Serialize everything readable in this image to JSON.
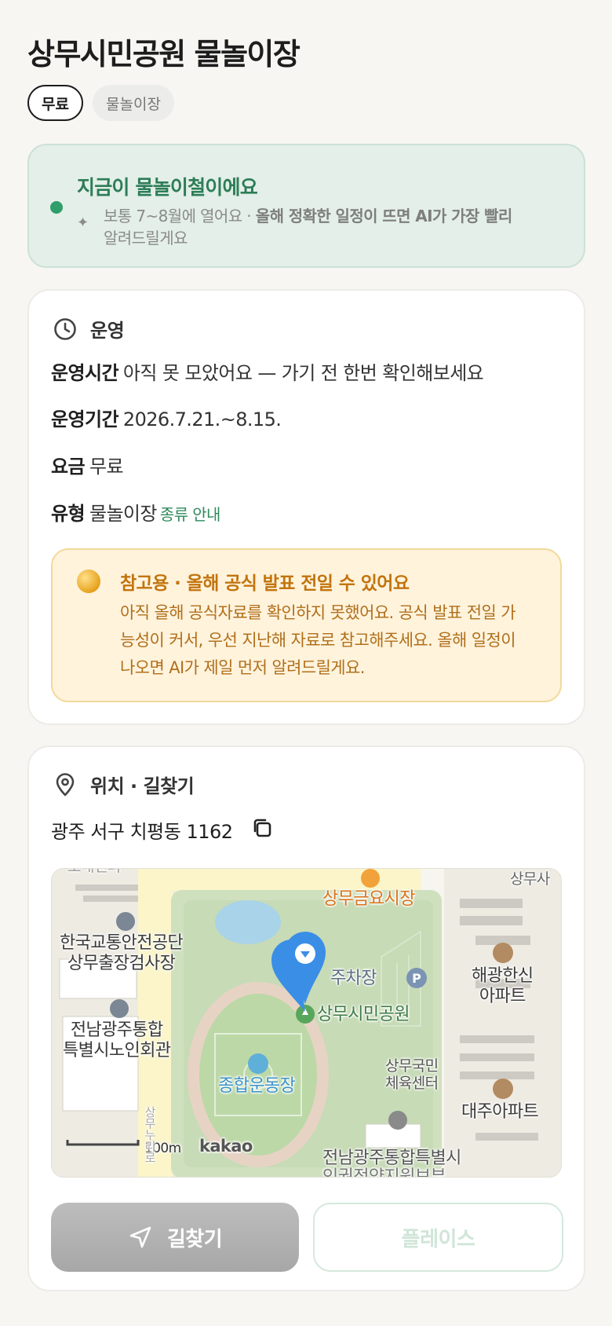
{
  "page": {
    "title": "상무시민공원 물놀이장"
  },
  "chips": {
    "free": "무료",
    "type": "물놀이장"
  },
  "banner": {
    "title": "지금이 물놀이철이에요",
    "desc_plain": "보통 7~8월에 열어요 · ",
    "desc_bold": "올해 정확한 일정이 뜨면 AI가 가장 빨리",
    "desc_tail": "알려드릴게요",
    "spark_icon": "sparkle-icon"
  },
  "operation": {
    "title": "운영",
    "icon": "clock-icon",
    "hours_label": "운영시간",
    "hours_value": "아직 못 모았어요 — 가기 전 한번 확인해보세요",
    "period_label": "운영기간",
    "period_value": "2026.7.21.~8.15.",
    "fee_label": "요금",
    "fee_value": "무료",
    "type_label": "유형",
    "type_value": "물놀이장",
    "type_link": "종류 안내",
    "notice": {
      "title": "참고용 · 올해 공식 발표 전일 수 있어요",
      "body": "아직 올해 공식자료를 확인하지 못했어요. 공식 발표 전일 가능성이 커서, 우선 지난해 자료로 참고해주세요. 올해 일정이 나오면 AI가 제일 먼저 알려드릴게요."
    }
  },
  "location": {
    "title": "위치 · 길찾기",
    "icon": "map-pin-icon",
    "address": "광주 서구 치평동 1162",
    "copy_icon": "copy-icon",
    "map": {
      "labels": {
        "transport": "한국교통안전공단\n상무출장검사장",
        "senior": "전남광주통합\n특별시노인회관",
        "market": "상무금요시장",
        "parking": "주차장",
        "park": "상무시민공원",
        "apt1": "해광한신\n아파트",
        "sports": "상무국민\n체육센터",
        "stadium": "종합운동장",
        "apt2": "대주아파트",
        "bottom": "전남광주통합특별시",
        "bottom2": "인권정약지원보부",
        "topright": "상무사",
        "scale": "100m",
        "brand": "kakao",
        "road": "상무누리로",
        "topleft": "도매센터"
      }
    },
    "route_button": "길찾기",
    "place_button": "플레이스"
  },
  "colors": {
    "accent_green": "#2d7d57",
    "banner_bg": "#e3efe8",
    "notice_bg": "#fff3dc",
    "notice_text": "#c2740d",
    "pin_blue": "#3a8ee6"
  }
}
